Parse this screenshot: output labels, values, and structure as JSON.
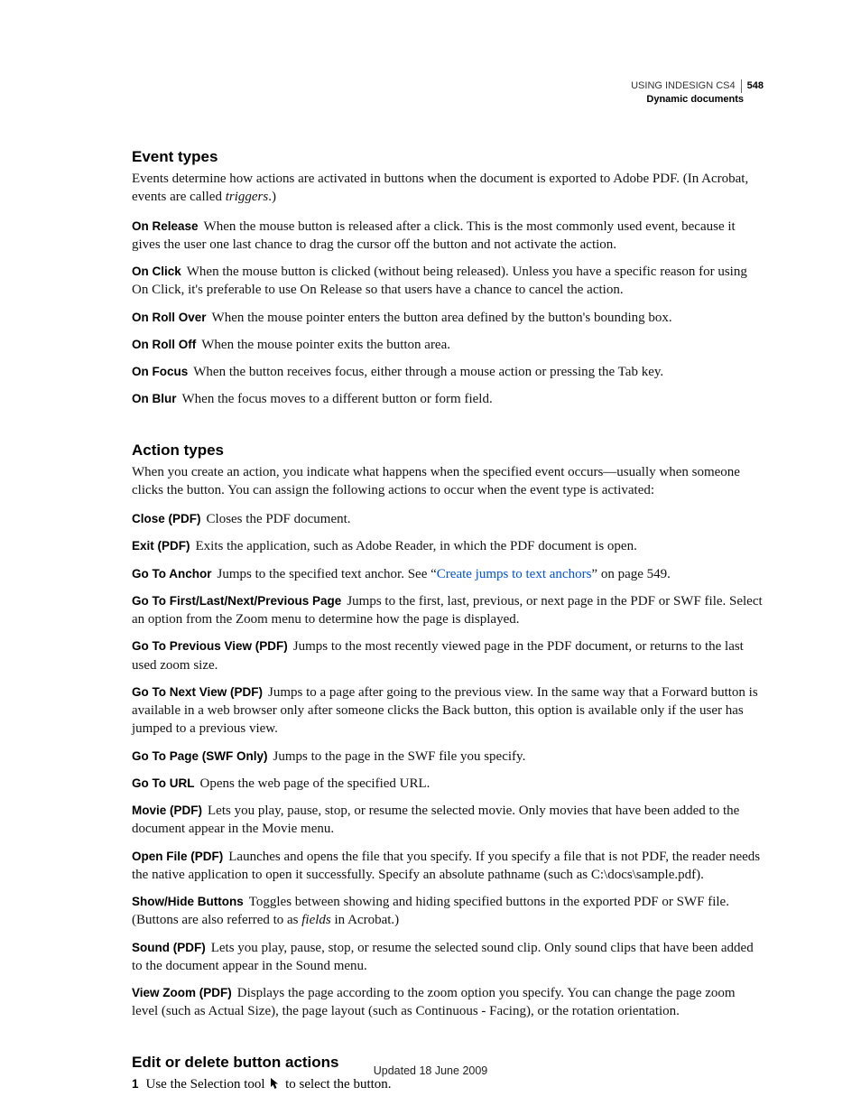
{
  "header": {
    "product": "USING INDESIGN CS4",
    "pagenum": "548",
    "section": "Dynamic documents"
  },
  "sections": {
    "events": {
      "title": "Event types",
      "intro1": "Events determine how actions are activated in buttons when the document is exported to Adobe PDF. (In Acrobat, events are called ",
      "intro_em": "triggers",
      "intro2": ".)",
      "items": {
        "onRelease": {
          "term": "On Release",
          "body": "When the mouse button is released after a click. This is the most commonly used event, because it gives the user one last chance to drag the cursor off the button and not activate the action."
        },
        "onClick": {
          "term": "On Click",
          "body": "When the mouse button is clicked (without being released). Unless you have a specific reason for using On Click, it's preferable to use On Release so that users have a chance to cancel the action."
        },
        "onRollOver": {
          "term": "On Roll Over",
          "body": "When the mouse pointer enters the button area defined by the button's bounding box."
        },
        "onRollOff": {
          "term": "On Roll Off",
          "body": "When the mouse pointer exits the button area."
        },
        "onFocus": {
          "term": "On Focus",
          "body": "When the button receives focus, either through a mouse action or pressing the Tab key."
        },
        "onBlur": {
          "term": "On Blur",
          "body": "When the focus moves to a different button or form field."
        }
      }
    },
    "actions": {
      "title": "Action types",
      "intro": "When you create an action, you indicate what happens when the specified event occurs—usually when someone clicks the button. You can assign the following actions to occur when the event type is activated:",
      "items": {
        "close": {
          "term": "Close (PDF)",
          "body": "Closes the PDF document."
        },
        "exit": {
          "term": "Exit (PDF)",
          "body": "Exits the application, such as Adobe Reader, in which the PDF document is open."
        },
        "anchor": {
          "term": "Go To Anchor",
          "pre": "Jumps to the specified text anchor. See “",
          "link": "Create jumps to text anchors",
          "post": "” on page 549."
        },
        "nav": {
          "term": "Go To First/Last/Next/Previous Page",
          "body": "Jumps to the first, last, previous, or next page in the PDF or SWF file. Select an option from the Zoom menu to determine how the page is displayed."
        },
        "prevView": {
          "term": "Go To Previous View (PDF)",
          "body": "Jumps to the most recently viewed page in the PDF document, or returns to the last used zoom size."
        },
        "nextView": {
          "term": "Go To Next View (PDF)",
          "body": "Jumps to a page after going to the previous view. In the same way that a Forward button is available in a web browser only after someone clicks the Back button, this option is available only if the user has jumped to a previous view."
        },
        "gotoPage": {
          "term": "Go To Page (SWF Only)",
          "body": "Jumps to the page in the SWF file you specify."
        },
        "gotoUrl": {
          "term": "Go To URL",
          "body": "Opens the web page of the specified URL."
        },
        "movie": {
          "term": "Movie (PDF)",
          "body": "Lets you play, pause, stop, or resume the selected movie. Only movies that have been added to the document appear in the Movie menu."
        },
        "openfile": {
          "term": "Open File (PDF)",
          "body": "Launches and opens the file that you specify. If you specify a file that is not PDF, the reader needs the native application to open it successfully. Specify an absolute pathname (such as C:\\docs\\sample.pdf)."
        },
        "showhide": {
          "term": "Show/Hide Buttons",
          "pre": "Toggles between showing and hiding specified buttons in the exported PDF or SWF file. (Buttons are also referred to as ",
          "em": "fields",
          "post": " in Acrobat.)"
        },
        "sound": {
          "term": "Sound (PDF)",
          "body": "Lets you play, pause, stop, or resume the selected sound clip. Only sound clips that have been added to the document appear in the Sound menu."
        },
        "viewzoom": {
          "term": "View Zoom (PDF)",
          "body": "Displays the page according to the zoom option you specify. You can change the page zoom level (such as Actual Size), the page layout (such as Continuous - Facing), or the rotation orientation."
        }
      }
    },
    "edit": {
      "title": "Edit or delete button actions",
      "step1_num": "1",
      "step1_a": "Use the Selection tool ",
      "step1_b": " to select the button."
    }
  },
  "footer": {
    "updated": "Updated 18 June 2009"
  }
}
